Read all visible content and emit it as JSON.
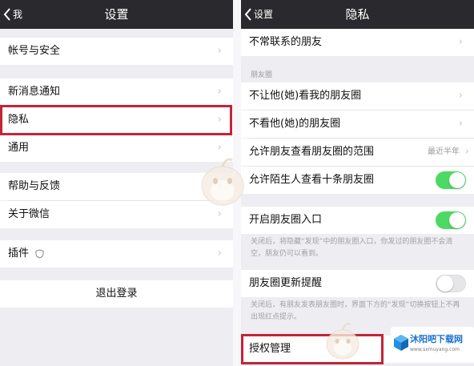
{
  "left": {
    "title": "设置",
    "back_label": "我",
    "rows": [
      {
        "label": "帐号与安全"
      },
      {
        "label": "新消息通知"
      },
      {
        "label": "隐私"
      },
      {
        "label": "通用"
      },
      {
        "label": "帮助与反馈"
      },
      {
        "label": "关于微信"
      },
      {
        "label": "插件"
      }
    ],
    "logout_label": "退出登录"
  },
  "right": {
    "title": "隐私",
    "back_label": "设置",
    "rows": {
      "infrequent": "不常联系的朋友",
      "moments_section": "朋友圈",
      "block_view": "不让他(她)看我的朋友圈",
      "hide_theirs": "不看他(她)的朋友圈",
      "range": "允许朋友查看朋友圈的范围",
      "range_value": "最近半年",
      "strangers": "允许陌生人查看十条朋友圈",
      "entrance": "开启朋友圈入口",
      "entrance_note": "关闭后，将隐藏“发现”中的朋友圈入口，你发过的朋友圈不会清空，朋友仍可以看到。",
      "update_reminder": "朋友圈更新提醒",
      "update_note": "关闭后，有朋友发表朋友圈时，界面下方的“发现”切换按钮上不再出现红点提示。",
      "auth": "授权管理"
    },
    "toggles": {
      "strangers": true,
      "entrance": true,
      "update_reminder": false
    }
  },
  "accent": {
    "switch_on": "#4cd964",
    "highlight": "#c3243a",
    "navbar": "#2a2a2e"
  },
  "icons": {
    "back": "chevron-left-icon",
    "row": "chevron-right-icon",
    "plugin": "shield-icon"
  }
}
